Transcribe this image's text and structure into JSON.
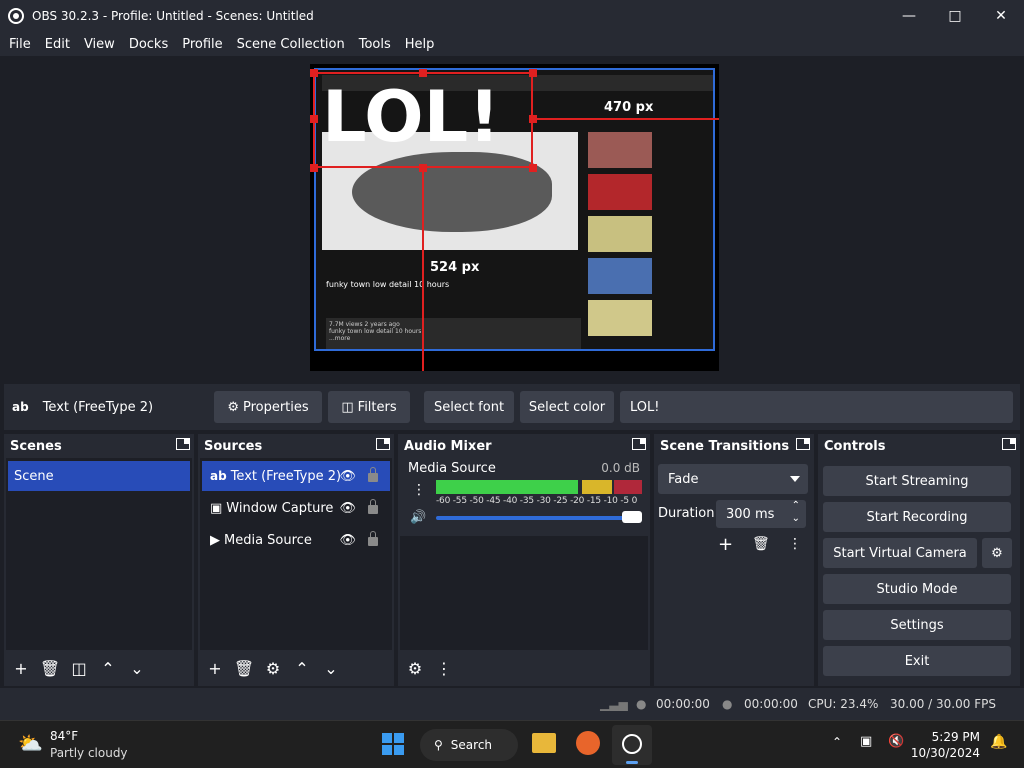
{
  "window": {
    "title": "OBS 30.2.3 - Profile: Untitled - Scenes: Untitled"
  },
  "menu": [
    "File",
    "Edit",
    "View",
    "Docks",
    "Profile",
    "Scene Collection",
    "Tools",
    "Help"
  ],
  "preview": {
    "overlay_text": "LOL!",
    "measure_h": "470 px",
    "measure_v": "524 px",
    "video_title": "funky town low detail 10 hours",
    "desc_line1": "7.7M views  2 years ago",
    "desc_line2": "funky town low detail 10 hours",
    "desc_more": "...more"
  },
  "source_toolbar": {
    "source_icon": "ab",
    "source_name": "Text (FreeType 2)",
    "properties": "Properties",
    "filters": "Filters",
    "select_font": "Select font",
    "select_color": "Select color",
    "text_value": "LOL!"
  },
  "scenes": {
    "title": "Scenes",
    "items": [
      "Scene"
    ]
  },
  "sources": {
    "title": "Sources",
    "items": [
      {
        "icon": "ab",
        "name": "Text (FreeType 2)"
      },
      {
        "icon": "window-icon",
        "name": "Window Capture"
      },
      {
        "icon": "play-icon",
        "name": "Media Source"
      }
    ]
  },
  "mixer": {
    "title": "Audio Mixer",
    "channel": "Media Source",
    "level": "0.0 dB",
    "ticks": "-60 -55 -50 -45 -40 -35 -30 -25 -20 -15 -10 -5 0"
  },
  "transitions": {
    "title": "Scene Transitions",
    "selected": "Fade",
    "duration_label": "Duration",
    "duration_value": "300 ms"
  },
  "controls": {
    "title": "Controls",
    "start_streaming": "Start Streaming",
    "start_recording": "Start Recording",
    "start_virtual_camera": "Start Virtual Camera",
    "studio_mode": "Studio Mode",
    "settings": "Settings",
    "exit": "Exit"
  },
  "status": {
    "stream_time": "00:00:00",
    "record_time": "00:00:00",
    "cpu": "CPU: 23.4%",
    "fps": "30.00 / 30.00 FPS"
  },
  "taskbar": {
    "temp": "84°F",
    "weather": "Partly cloudy",
    "search": "Search",
    "time": "5:29 PM",
    "date": "10/30/2024"
  },
  "colors": {
    "accent": "#284cb8",
    "selection": "#e02020",
    "capture_border": "#2f6bd8"
  }
}
